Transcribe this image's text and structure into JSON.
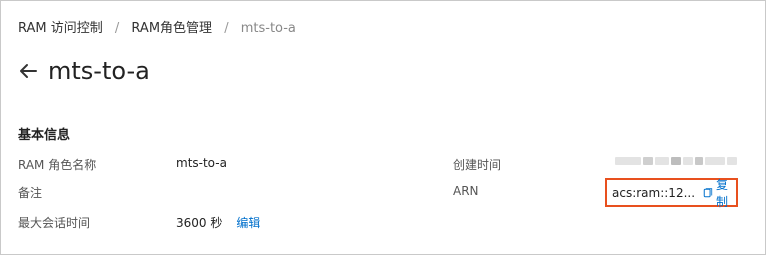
{
  "breadcrumb": {
    "items": [
      "RAM 访问控制",
      "RAM角色管理"
    ],
    "current": "mts-to-a",
    "separator": "/"
  },
  "header": {
    "title": "mts-to-a",
    "back_icon": "arrow-left-icon"
  },
  "section": {
    "title": "基本信息"
  },
  "fields": {
    "role_name": {
      "label": "RAM 角色名称",
      "value": "mts-to-a"
    },
    "note": {
      "label": "备注",
      "value": ""
    },
    "session": {
      "label": "最大会话时间",
      "value": "3600 秒",
      "edit_label": "编辑"
    },
    "created": {
      "label": "创建时间",
      "value": ""
    },
    "arn": {
      "label": "ARN",
      "value": "acs:ram::12...",
      "copy_label": "复制",
      "copy_icon": "copy-icon"
    }
  },
  "colors": {
    "link": "#0070cc",
    "highlight_border": "#e8501e"
  }
}
